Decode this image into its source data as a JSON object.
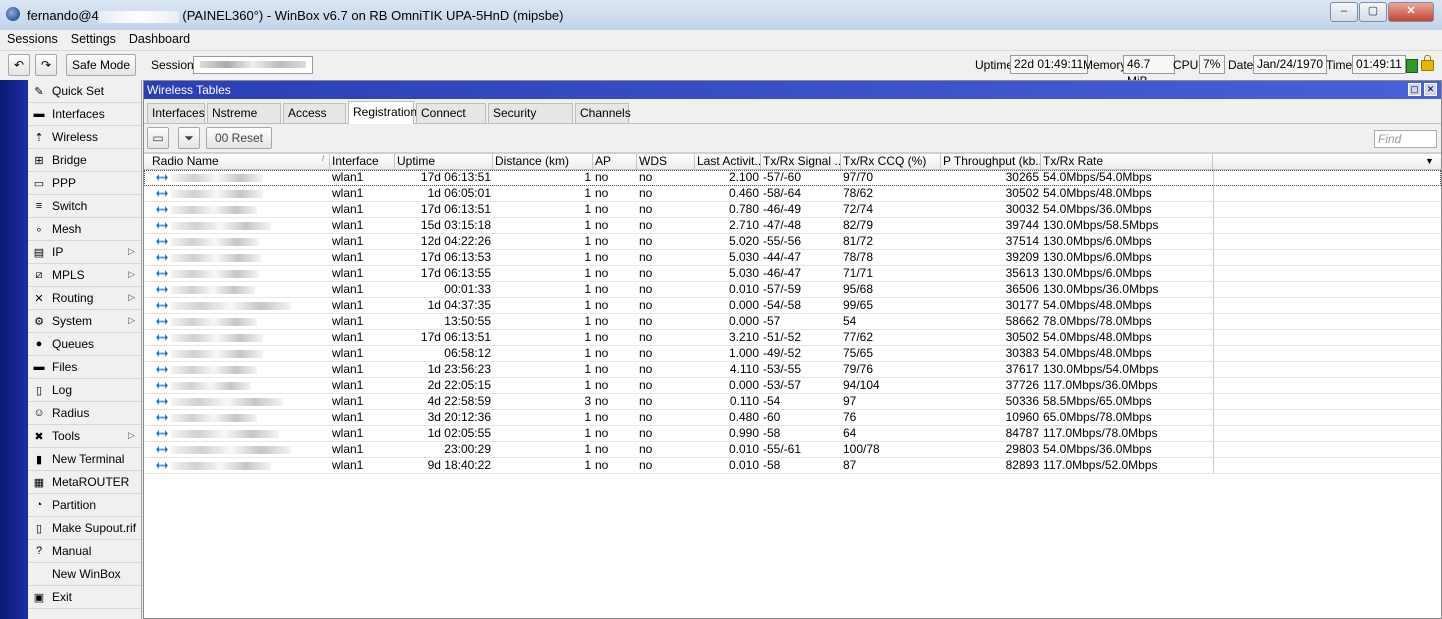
{
  "window": {
    "title_prefix": "fernando@4",
    "title_suffix": "(PAINEL360°) - WinBox v6.7 on RB OmniTIK UPA-5HnD (mipsbe)",
    "buttons": [
      "–",
      "▢",
      "✕"
    ]
  },
  "menu": [
    "Sessions",
    "Settings",
    "Dashboard"
  ],
  "toolbar": {
    "undo": "↶",
    "redo": "↷",
    "safe_mode": "Safe Mode",
    "session_label": "Session:",
    "uptime_label": "Uptime:",
    "uptime": "22d 01:49:11",
    "memory_label": "Memory:",
    "memory": "46.7 MiB",
    "cpu_label": "CPU:",
    "cpu": "7%",
    "date_label": "Date:",
    "date": "Jan/24/1970",
    "time_label": "Time:",
    "time": "01:49:11"
  },
  "sidebar": [
    {
      "label": "Quick Set",
      "icon": "quick-set-icon",
      "glyph": "✎",
      "arrow": false
    },
    {
      "label": "Interfaces",
      "icon": "interfaces-icon",
      "glyph": "▬",
      "arrow": false
    },
    {
      "label": "Wireless",
      "icon": "wireless-icon",
      "glyph": "⇡",
      "arrow": false
    },
    {
      "label": "Bridge",
      "icon": "bridge-icon",
      "glyph": "⊞",
      "arrow": false
    },
    {
      "label": "PPP",
      "icon": "ppp-icon",
      "glyph": "▭",
      "arrow": false
    },
    {
      "label": "Switch",
      "icon": "switch-icon",
      "glyph": "≡",
      "arrow": false
    },
    {
      "label": "Mesh",
      "icon": "mesh-icon",
      "glyph": "∘",
      "arrow": false
    },
    {
      "label": "IP",
      "icon": "ip-icon",
      "glyph": "▤",
      "arrow": true
    },
    {
      "label": "MPLS",
      "icon": "mpls-icon",
      "glyph": "⧄",
      "arrow": true
    },
    {
      "label": "Routing",
      "icon": "routing-icon",
      "glyph": "✕",
      "arrow": true
    },
    {
      "label": "System",
      "icon": "system-icon",
      "glyph": "⚙",
      "arrow": true
    },
    {
      "label": "Queues",
      "icon": "queues-icon",
      "glyph": "●",
      "arrow": false
    },
    {
      "label": "Files",
      "icon": "files-icon",
      "glyph": "▬",
      "arrow": false
    },
    {
      "label": "Log",
      "icon": "log-icon",
      "glyph": "▯",
      "arrow": false
    },
    {
      "label": "Radius",
      "icon": "radius-icon",
      "glyph": "☺",
      "arrow": false
    },
    {
      "label": "Tools",
      "icon": "tools-icon",
      "glyph": "✖",
      "arrow": true
    },
    {
      "label": "New Terminal",
      "icon": "terminal-icon",
      "glyph": "▮",
      "arrow": false
    },
    {
      "label": "MetaROUTER",
      "icon": "metarouter-icon",
      "glyph": "▦",
      "arrow": false
    },
    {
      "label": "Partition",
      "icon": "partition-icon",
      "glyph": "◔",
      "arrow": false
    },
    {
      "label": "Make Supout.rif",
      "icon": "supout-icon",
      "glyph": "▯",
      "arrow": false
    },
    {
      "label": "Manual",
      "icon": "manual-icon",
      "glyph": "?",
      "arrow": false
    },
    {
      "label": "New WinBox",
      "icon": "",
      "glyph": "",
      "arrow": false
    },
    {
      "label": "Exit",
      "icon": "exit-icon",
      "glyph": "▣",
      "arrow": false
    }
  ],
  "wireless_tables": {
    "title": "Wireless Tables",
    "tabs": [
      "Interfaces",
      "Nstreme Dual",
      "Access List",
      "Registration",
      "Connect List",
      "Security Profiles",
      "Channels"
    ],
    "active_tab": "Registration",
    "reset_label": "Reset",
    "reset_prefix": "00",
    "find_placeholder": "Find",
    "columns": [
      "Radio Name",
      "Interface",
      "Uptime",
      "Distance (km)",
      "AP",
      "WDS",
      "Last Activit...",
      "Tx/Rx Signal ...",
      "Tx/Rx CCQ (%)",
      "P Throughput (kb...",
      "Tx/Rx Rate"
    ],
    "rows": [
      [
        "wlan1",
        "17d 06:13:51",
        "1",
        "no",
        "no",
        "2.100",
        "-57/-60",
        "97/70",
        "30265",
        "54.0Mbps/54.0Mbps"
      ],
      [
        "wlan1",
        "1d 06:05:01",
        "1",
        "no",
        "no",
        "0.460",
        "-58/-64",
        "78/62",
        "30502",
        "54.0Mbps/48.0Mbps"
      ],
      [
        "wlan1",
        "17d 06:13:51",
        "1",
        "no",
        "no",
        "0.780",
        "-46/-49",
        "72/74",
        "30032",
        "54.0Mbps/36.0Mbps"
      ],
      [
        "wlan1",
        "15d 03:15:18",
        "1",
        "no",
        "no",
        "2.710",
        "-47/-48",
        "82/79",
        "39744",
        "130.0Mbps/58.5Mbps"
      ],
      [
        "wlan1",
        "12d 04:22:26",
        "1",
        "no",
        "no",
        "5.020",
        "-55/-56",
        "81/72",
        "37514",
        "130.0Mbps/6.0Mbps"
      ],
      [
        "wlan1",
        "17d 06:13:53",
        "1",
        "no",
        "no",
        "5.030",
        "-44/-47",
        "78/78",
        "39209",
        "130.0Mbps/6.0Mbps"
      ],
      [
        "wlan1",
        "17d 06:13:55",
        "1",
        "no",
        "no",
        "5.030",
        "-46/-47",
        "71/71",
        "35613",
        "130.0Mbps/6.0Mbps"
      ],
      [
        "wlan1",
        "00:01:33",
        "1",
        "no",
        "no",
        "0.010",
        "-57/-59",
        "95/68",
        "36506",
        "130.0Mbps/36.0Mbps"
      ],
      [
        "wlan1",
        "1d 04:37:35",
        "1",
        "no",
        "no",
        "0.000",
        "-54/-58",
        "99/65",
        "30177",
        "54.0Mbps/48.0Mbps"
      ],
      [
        "wlan1",
        "13:50:55",
        "1",
        "no",
        "no",
        "0.000",
        "-57",
        "54",
        "58662",
        "78.0Mbps/78.0Mbps"
      ],
      [
        "wlan1",
        "17d 06:13:51",
        "1",
        "no",
        "no",
        "3.210",
        "-51/-52",
        "77/62",
        "30502",
        "54.0Mbps/48.0Mbps"
      ],
      [
        "wlan1",
        "06:58:12",
        "1",
        "no",
        "no",
        "1.000",
        "-49/-52",
        "75/65",
        "30383",
        "54.0Mbps/48.0Mbps"
      ],
      [
        "wlan1",
        "1d 23:56:23",
        "1",
        "no",
        "no",
        "4.110",
        "-53/-55",
        "79/76",
        "37617",
        "130.0Mbps/54.0Mbps"
      ],
      [
        "wlan1",
        "2d 22:05:15",
        "1",
        "no",
        "no",
        "0.000",
        "-53/-57",
        "94/104",
        "37726",
        "117.0Mbps/36.0Mbps"
      ],
      [
        "wlan1",
        "4d 22:58:59",
        "3",
        "no",
        "no",
        "0.110",
        "-54",
        "97",
        "50336",
        "58.5Mbps/65.0Mbps"
      ],
      [
        "wlan1",
        "3d 20:12:36",
        "1",
        "no",
        "no",
        "0.480",
        "-60",
        "76",
        "10960",
        "65.0Mbps/78.0Mbps"
      ],
      [
        "wlan1",
        "1d 02:05:55",
        "1",
        "no",
        "no",
        "0.990",
        "-58",
        "64",
        "84787",
        "117.0Mbps/78.0Mbps"
      ],
      [
        "wlan1",
        "23:00:29",
        "1",
        "no",
        "no",
        "0.010",
        "-55/-61",
        "100/78",
        "29803",
        "54.0Mbps/36.0Mbps"
      ],
      [
        "wlan1",
        "9d 18:40:22",
        "1",
        "no",
        "no",
        "0.010",
        "-58",
        "87",
        "82893",
        "117.0Mbps/52.0Mbps"
      ]
    ]
  },
  "colors": {
    "accent_blue": "#2a3fb6",
    "left_stripe": "#1b2fa8",
    "status_green": "#2e9a2e",
    "lock_yellow": "#e6b800"
  }
}
